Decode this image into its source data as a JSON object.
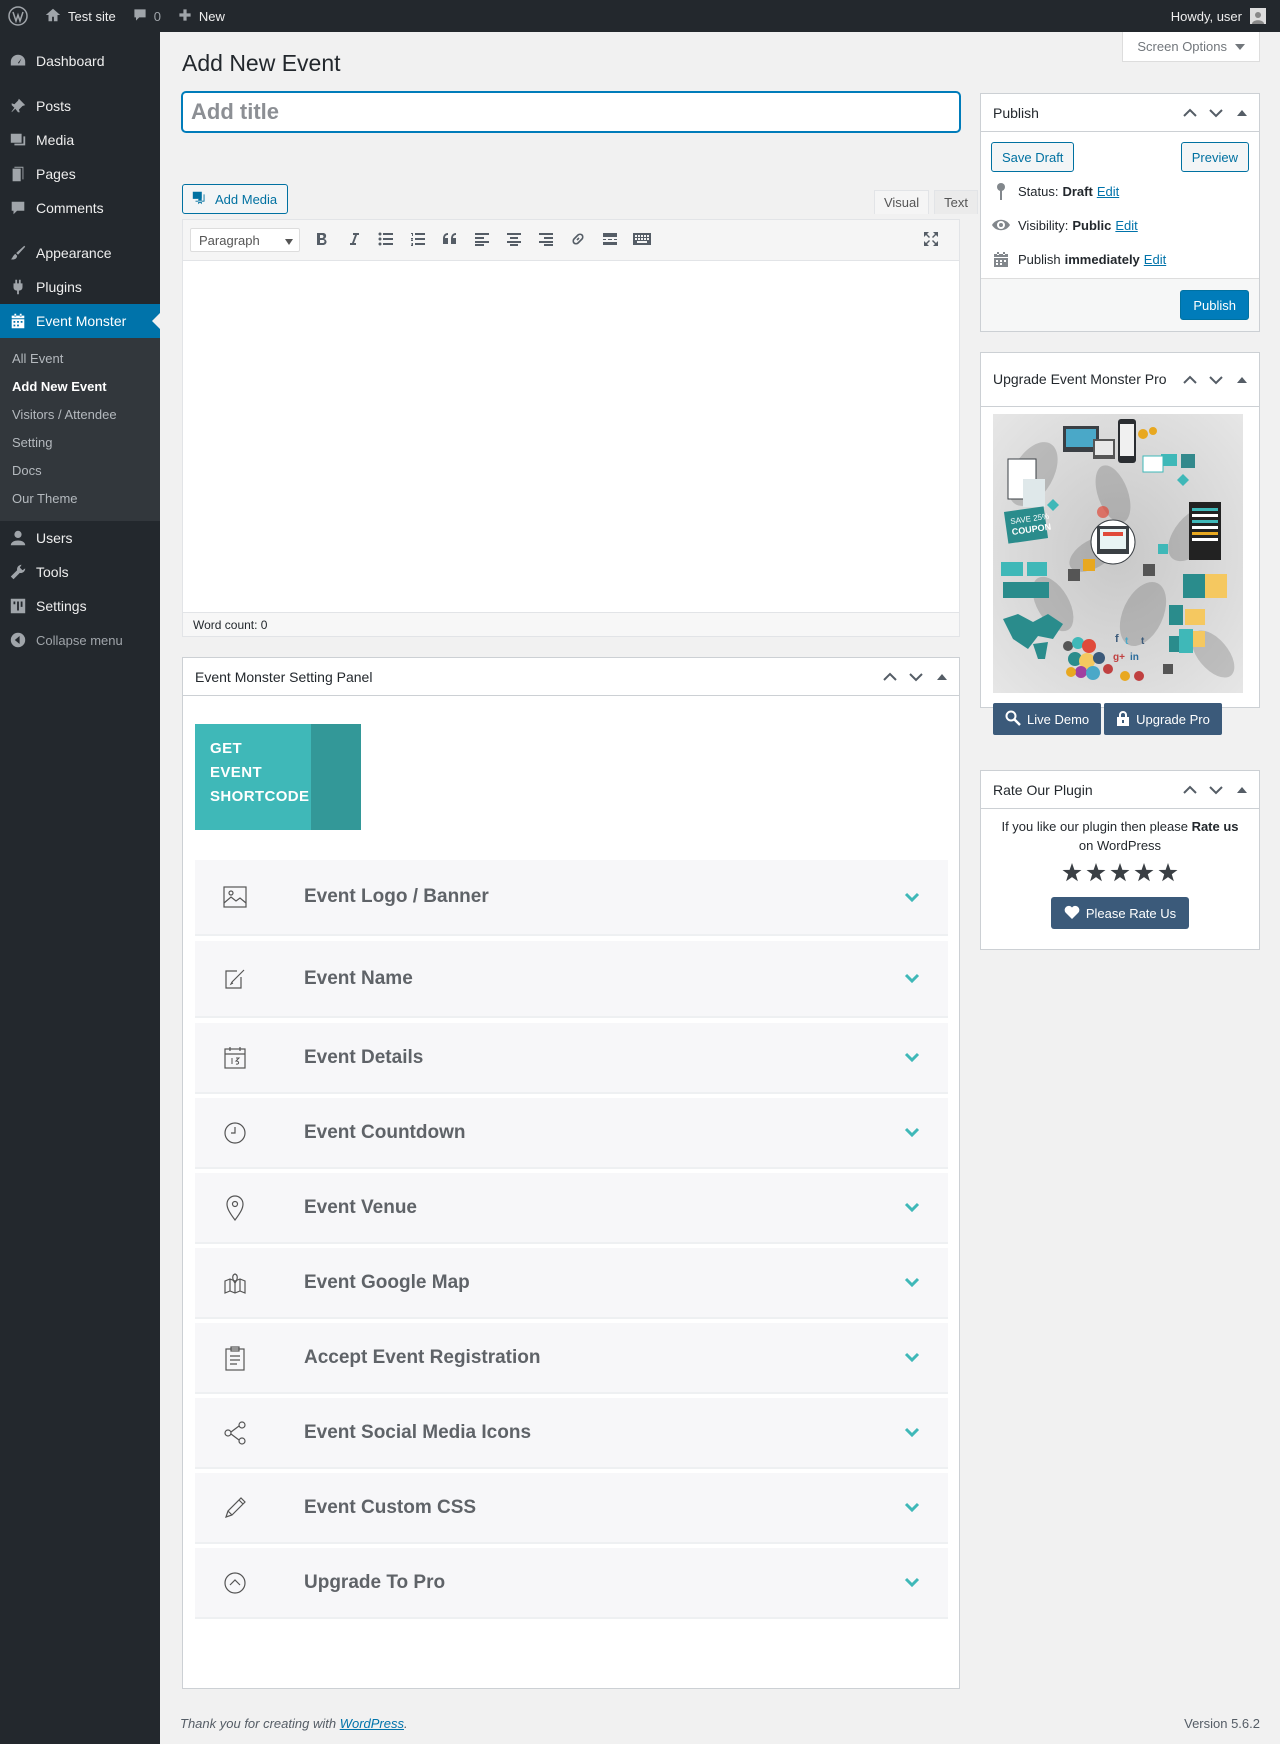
{
  "adminbar": {
    "site_name": "Test site",
    "comments_count": "0",
    "new_label": "New",
    "howdy": "Howdy, user"
  },
  "sidebar": {
    "items_top": [
      {
        "label": "Dashboard",
        "icon": "dashboard-icon"
      }
    ],
    "items_main": [
      {
        "label": "Posts",
        "icon": "pin-icon"
      },
      {
        "label": "Media",
        "icon": "media-icon"
      },
      {
        "label": "Pages",
        "icon": "pages-icon"
      },
      {
        "label": "Comments",
        "icon": "comment-icon"
      }
    ],
    "items_appearance": [
      {
        "label": "Appearance",
        "icon": "brush-icon"
      },
      {
        "label": "Plugins",
        "icon": "plugin-icon"
      }
    ],
    "current": {
      "label": "Event Monster",
      "icon": "calendar-icon"
    },
    "submenu": [
      "All Event",
      "Add New Event",
      "Visitors / Attendee",
      "Setting",
      "Docs",
      "Our Theme"
    ],
    "items_bottom": [
      {
        "label": "Users",
        "icon": "user-icon"
      },
      {
        "label": "Tools",
        "icon": "wrench-icon"
      },
      {
        "label": "Settings",
        "icon": "settings-icon"
      }
    ],
    "collapse": "Collapse menu"
  },
  "screen_options": "Screen Options",
  "page_title": "Add New Event",
  "title_placeholder": "Add title",
  "editor": {
    "add_media": "Add Media",
    "tab_visual": "Visual",
    "tab_text": "Text",
    "format": "Paragraph",
    "word_count": "Word count: 0"
  },
  "setting_panel": {
    "title": "Event Monster Setting Panel",
    "shortcode_lines": [
      "GET",
      "EVENT",
      "SHORTCODE"
    ],
    "sections": [
      {
        "label": "Event Logo / Banner",
        "icon": "image-icon"
      },
      {
        "label": "Event Name",
        "icon": "edit-icon"
      },
      {
        "label": "Event Details",
        "icon": "calendar-date-icon"
      },
      {
        "label": "Event Countdown",
        "icon": "clock-icon"
      },
      {
        "label": "Event Venue",
        "icon": "location-pin-icon"
      },
      {
        "label": "Event Google Map",
        "icon": "map-icon"
      },
      {
        "label": "Accept Event Registration",
        "icon": "clipboard-icon"
      },
      {
        "label": "Event Social Media Icons",
        "icon": "share-icon"
      },
      {
        "label": "Event Custom CSS",
        "icon": "pencil-icon"
      },
      {
        "label": "Upgrade To Pro",
        "icon": "arrow-up-circle-icon"
      }
    ]
  },
  "publish": {
    "title": "Publish",
    "save_draft": "Save Draft",
    "preview": "Preview",
    "status_label": "Status:",
    "status_value": "Draft",
    "visibility_label": "Visibility:",
    "visibility_value": "Public",
    "publish_label": "Publish",
    "publish_value": "immediately",
    "edit": "Edit",
    "publish_button": "Publish"
  },
  "upgrade": {
    "title": "Upgrade Event Monster Pro",
    "live_demo": "Live Demo",
    "upgrade_pro": "Upgrade Pro"
  },
  "rate": {
    "title": "Rate Our Plugin",
    "text_before": "If you like our plugin then please",
    "text_bold": "Rate us",
    "text_after": "on WordPress",
    "stars": 5,
    "button": "Please Rate Us"
  },
  "footer": {
    "thanks": "Thank you for creating with",
    "link": "WordPress",
    "version": "Version 5.6.2"
  },
  "colors": {
    "accent": "#0073aa",
    "sidebar_bg": "#23282d",
    "teal": "#3fb8b8",
    "dark_button": "#3b5a7a"
  }
}
